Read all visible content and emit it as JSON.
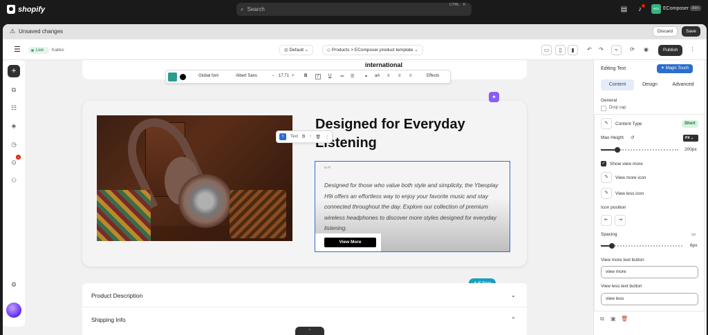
{
  "topbar": {
    "brand": "shopify",
    "search_placeholder": "Search",
    "search_shortcut_1": "CTRL",
    "search_shortcut_2": "K",
    "store_initials": "ecs",
    "store_name": "EComposer",
    "store_tag": "dev"
  },
  "savebar": {
    "message": "Unsaved changes",
    "discard": "Discard",
    "save": "Save"
  },
  "toolbar": {
    "status": "Live",
    "theme": "Kalles",
    "view_select": "Default",
    "template_select": "Products > EComposer product template",
    "publish": "Publish"
  },
  "canvas": {
    "top_heading": "international",
    "format_bar": {
      "font": "Global font",
      "family": "Albert Sans",
      "size": "17.71",
      "effects": "Effects"
    },
    "chip_label": "Text",
    "headline": "Designed for Everyday Listening",
    "description": "Designed for those who value both style and simplicity, the Ybeoplay H9i offers an effortless way to enjoy your favorite music and stay connected throughout the day. Explore our collection of premium wireless headphones to discover more styles designed for everyday listening.",
    "view_more": "View More",
    "ai_page": "AI Page",
    "accordion": [
      "Product Description",
      "Shipping Info"
    ]
  },
  "panel": {
    "title": "Editing Text",
    "magic": "Magic Touch",
    "tabs": [
      "Content",
      "Design",
      "Advanced"
    ],
    "active_tab": "Content",
    "general": "General",
    "drop_cap": "Drop cap",
    "content_type_label": "Content Type",
    "content_type_value": "Short",
    "max_height_label": "Max Height",
    "max_height_unit": "PX",
    "max_height_value": "200px",
    "max_height_level": 0.2,
    "show_view_more": "Show view more",
    "view_more_icon": "View more icon",
    "view_less_icon": "View less icon",
    "icon_position": "Icon position",
    "spacing": "Spacing",
    "spacing_value": "6px",
    "spacing_level": 0.12,
    "view_more_text_label": "View more text button",
    "view_more_text_value": "view more",
    "view_less_text_label": "View less text button",
    "view_less_text_value": "view less"
  },
  "colors": {
    "accent": "#2c6ecb",
    "live": "#36b37e",
    "dark": "#303030"
  }
}
